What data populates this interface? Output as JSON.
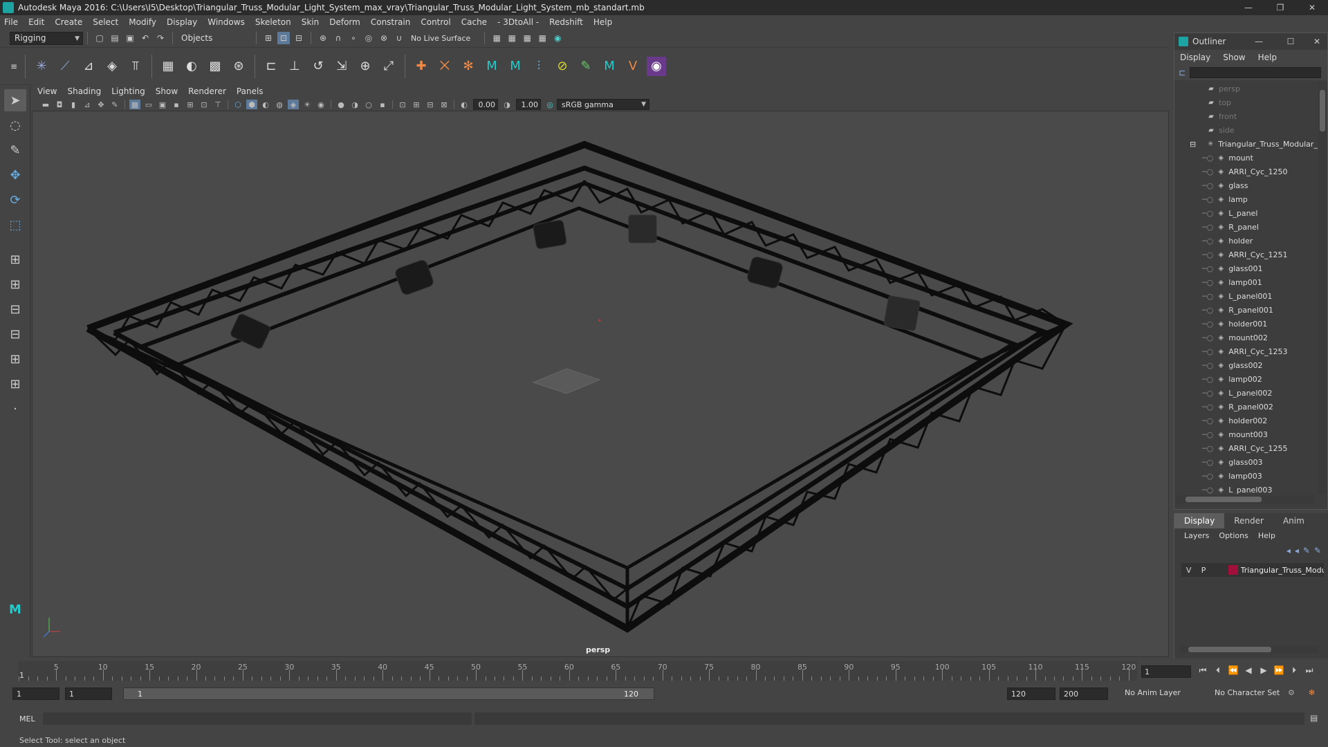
{
  "window": {
    "title": "Autodesk Maya 2016: C:\\Users\\I5\\Desktop\\Triangular_Truss_Modular_Light_System_max_vray\\Triangular_Truss_Modular_Light_System_mb_standart.mb",
    "minimize": "—",
    "maximize": "❐",
    "close": "✕"
  },
  "menubar": [
    "File",
    "Edit",
    "Create",
    "Select",
    "Modify",
    "Display",
    "Windows",
    "Skeleton",
    "Skin",
    "Deform",
    "Constrain",
    "Control",
    "Cache",
    "- 3DtoAll -",
    "Redshift",
    "Help"
  ],
  "statusline": {
    "menu_set": "Rigging",
    "selection_mode": "Objects",
    "live_surface": "No Live Surface"
  },
  "viewport": {
    "menu": [
      "View",
      "Shading",
      "Lighting",
      "Show",
      "Renderer",
      "Panels"
    ],
    "exposure": "0.00",
    "gamma": "1.00",
    "color_space": "sRGB gamma",
    "camera": "persp"
  },
  "outliner": {
    "title": "Outliner",
    "menu": [
      "Display",
      "Show",
      "Help"
    ],
    "items": [
      {
        "label": "persp",
        "type": "camera",
        "dim": true,
        "indent": 1
      },
      {
        "label": "top",
        "type": "camera",
        "dim": true,
        "indent": 1
      },
      {
        "label": "front",
        "type": "camera",
        "dim": true,
        "indent": 1
      },
      {
        "label": "side",
        "type": "camera",
        "dim": true,
        "indent": 1
      },
      {
        "label": "Triangular_Truss_Modular_",
        "type": "group",
        "dim": false,
        "indent": 0
      },
      {
        "label": "mount",
        "type": "mesh",
        "dim": false,
        "indent": 2
      },
      {
        "label": "ARRI_Cyc_1250",
        "type": "mesh",
        "dim": false,
        "indent": 2
      },
      {
        "label": "glass",
        "type": "mesh",
        "dim": false,
        "indent": 2
      },
      {
        "label": "lamp",
        "type": "mesh",
        "dim": false,
        "indent": 2
      },
      {
        "label": "L_panel",
        "type": "mesh",
        "dim": false,
        "indent": 2
      },
      {
        "label": "R_panel",
        "type": "mesh",
        "dim": false,
        "indent": 2
      },
      {
        "label": "holder",
        "type": "mesh",
        "dim": false,
        "indent": 2
      },
      {
        "label": "ARRI_Cyc_1251",
        "type": "mesh",
        "dim": false,
        "indent": 2
      },
      {
        "label": "glass001",
        "type": "mesh",
        "dim": false,
        "indent": 2
      },
      {
        "label": "lamp001",
        "type": "mesh",
        "dim": false,
        "indent": 2
      },
      {
        "label": "L_panel001",
        "type": "mesh",
        "dim": false,
        "indent": 2
      },
      {
        "label": "R_panel001",
        "type": "mesh",
        "dim": false,
        "indent": 2
      },
      {
        "label": "holder001",
        "type": "mesh",
        "dim": false,
        "indent": 2
      },
      {
        "label": "mount002",
        "type": "mesh",
        "dim": false,
        "indent": 2
      },
      {
        "label": "ARRI_Cyc_1253",
        "type": "mesh",
        "dim": false,
        "indent": 2
      },
      {
        "label": "glass002",
        "type": "mesh",
        "dim": false,
        "indent": 2
      },
      {
        "label": "lamp002",
        "type": "mesh",
        "dim": false,
        "indent": 2
      },
      {
        "label": "L_panel002",
        "type": "mesh",
        "dim": false,
        "indent": 2
      },
      {
        "label": "R_panel002",
        "type": "mesh",
        "dim": false,
        "indent": 2
      },
      {
        "label": "holder002",
        "type": "mesh",
        "dim": false,
        "indent": 2
      },
      {
        "label": "mount003",
        "type": "mesh",
        "dim": false,
        "indent": 2
      },
      {
        "label": "ARRI_Cyc_1255",
        "type": "mesh",
        "dim": false,
        "indent": 2
      },
      {
        "label": "glass003",
        "type": "mesh",
        "dim": false,
        "indent": 2
      },
      {
        "label": "lamp003",
        "type": "mesh",
        "dim": false,
        "indent": 2
      },
      {
        "label": "L_panel003",
        "type": "mesh",
        "dim": false,
        "indent": 2
      }
    ]
  },
  "layer_editor": {
    "tabs": [
      "Display",
      "Render",
      "Anim"
    ],
    "active_tab": "Display",
    "menu": [
      "Layers",
      "Options",
      "Help"
    ],
    "layer": {
      "v": "V",
      "p": "P",
      "name": "Triangular_Truss_Modu",
      "color": "#a0103a"
    }
  },
  "timeslider": {
    "ticks": [
      "5",
      "10",
      "15",
      "20",
      "25",
      "30",
      "35",
      "40",
      "45",
      "50",
      "55",
      "60",
      "65",
      "70",
      "75",
      "80",
      "85",
      "90",
      "95",
      "100",
      "105",
      "110",
      "115",
      "120"
    ],
    "start_label": "1",
    "current_frame": "1"
  },
  "rangeslider": {
    "start": "1",
    "playback_start": "1",
    "bar_start": "1",
    "bar_end": "120",
    "playback_end": "120",
    "end": "200",
    "anim_layer": "No Anim Layer",
    "character_set": "No Character Set"
  },
  "cmdline": {
    "label": "MEL"
  },
  "helpline": {
    "text": "Select Tool: select an object"
  }
}
